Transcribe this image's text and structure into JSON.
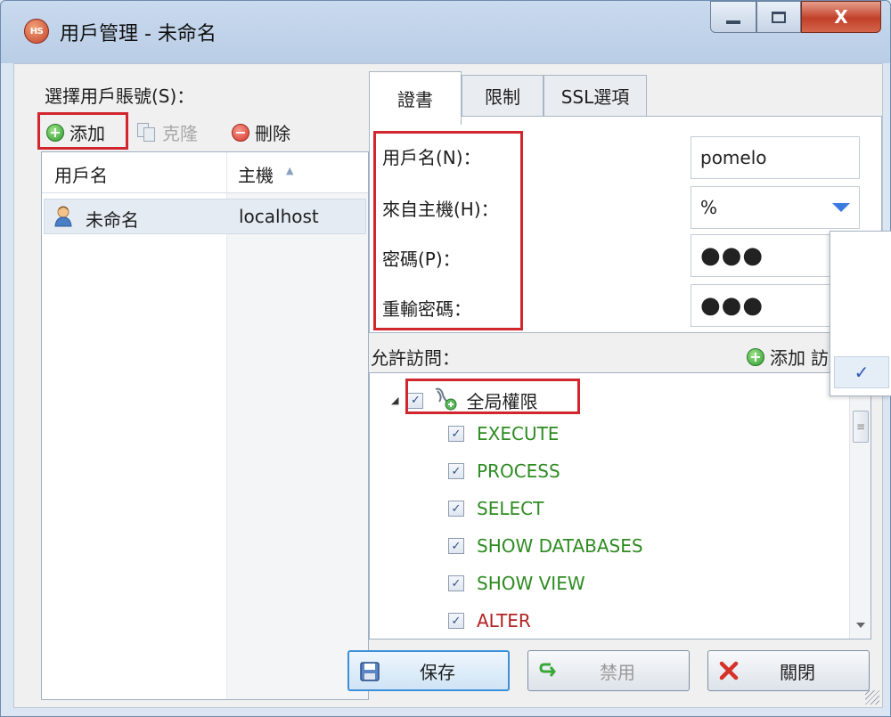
{
  "window": {
    "title": "用戶管理 - 未命名",
    "app_icon_text": "HS",
    "caption": {
      "close_label": "X"
    }
  },
  "left": {
    "select_label": "選擇用戶賬號(S)：",
    "toolbar": {
      "add_label": "添加",
      "clone_label": "克隆",
      "delete_label": "刪除"
    },
    "table": {
      "columns": [
        "用戶名",
        "主機"
      ],
      "sort_indicator": "▲",
      "rows": [
        {
          "user": "未命名",
          "host": "localhost"
        }
      ]
    }
  },
  "tabs": [
    "證書",
    "限制",
    "SSL選項"
  ],
  "form": {
    "username_label": "用戶名(N)：",
    "username_value": "pomelo",
    "host_label": "來自主機(H)：",
    "host_value": "%",
    "password_label": "密碼(P)：",
    "password_value": "●●●",
    "confirm_label": "重輸密碼：",
    "confirm_value": "●●●"
  },
  "access": {
    "label": "允許訪問：",
    "add_label": "添加",
    "add_label_overflow": "訪",
    "root": {
      "label": "全局權限",
      "checked": true
    },
    "privileges": [
      {
        "name": "EXECUTE",
        "color": "#2e8b22"
      },
      {
        "name": "PROCESS",
        "color": "#2e8b22"
      },
      {
        "name": "SELECT",
        "color": "#2e8b22"
      },
      {
        "name": "SHOW DATABASES",
        "color": "#2e8b22"
      },
      {
        "name": "SHOW VIEW",
        "color": "#2e8b22"
      },
      {
        "name": "ALTER",
        "color": "#b22222"
      }
    ]
  },
  "popup": {
    "check": "✓"
  },
  "buttons": {
    "save": "保存",
    "disable": "禁用",
    "close": "關閉"
  },
  "colors": {
    "highlight_box": "#d2262e",
    "accent": "#3b7be0"
  }
}
